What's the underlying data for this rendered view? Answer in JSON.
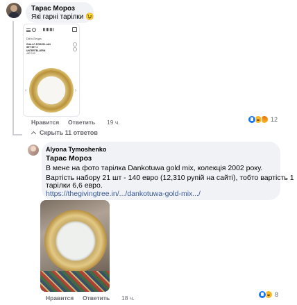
{
  "comment1": {
    "author": "Тарас Мороз",
    "text": "Які гарні тарілки 😉",
    "product": {
      "brand": "Dulcis Designs",
      "title": "GIALLO PORCELLAN SET MIT 4 UNTERTELLERN",
      "price": "480 EUR"
    },
    "actions": {
      "like": "Нравится",
      "reply": "Ответить",
      "time": "19 ч."
    },
    "reaction_count": "12"
  },
  "toggle_replies": "Скрыть 11 ответов",
  "reply1": {
    "author": "Alyona Tymoshenko",
    "mention": "Тарас Мороз",
    "line1": "В мене на фото тарілка Dankotuwa gold mix, колекція 2002 року.",
    "line2": "Вартість набору 21 шт - 140 евро (12,310 рупій на сайті), тобто вартість 1",
    "line3": "тарілки 6,6 евро.",
    "link": "https://thegivingtree.in/.../dankotuwa-gold-mix.../",
    "actions": {
      "like": "Нравится",
      "reply": "Ответить",
      "time": "18 ч."
    },
    "reaction_count": "8"
  },
  "colors": {
    "link": "#385898",
    "bubble": "#f0f2f5",
    "meta": "#65676b",
    "like": "#1877f2"
  }
}
